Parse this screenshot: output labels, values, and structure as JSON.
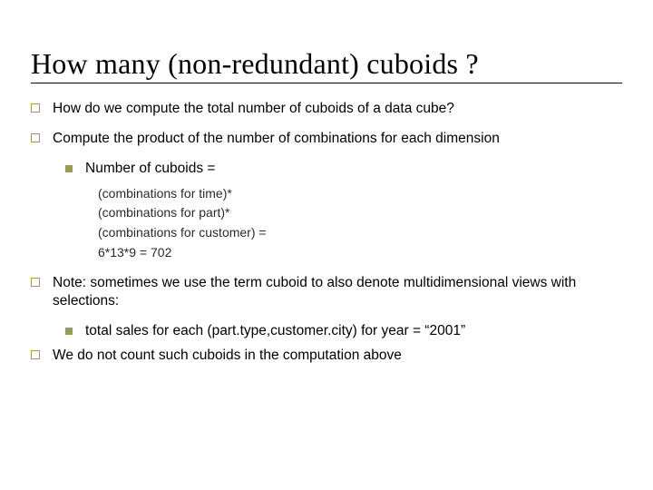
{
  "title": "How many (non-redundant) cuboids ?",
  "items": [
    {
      "level": 1,
      "text": "How do we compute the total number of cuboids of a data cube?"
    },
    {
      "level": 1,
      "text": "Compute the product of the number of combinations for each dimension"
    },
    {
      "level": 2,
      "text": "Number of cuboids ="
    },
    {
      "level": 3,
      "text": "(combinations for time)*"
    },
    {
      "level": 3,
      "text": "(combinations for part)*"
    },
    {
      "level": 3,
      "text": "(combinations for customer) ="
    },
    {
      "level": 3,
      "text": "6*13*9 = 702"
    },
    {
      "level": 1,
      "text": "Note: sometimes we use the term cuboid to also denote multidimensional views with selections:"
    },
    {
      "level": 2,
      "text": "total sales for each (part.type,customer.city) for year = “2001”"
    },
    {
      "level": 1,
      "text": "We do not count such cuboids in the computation above"
    }
  ]
}
